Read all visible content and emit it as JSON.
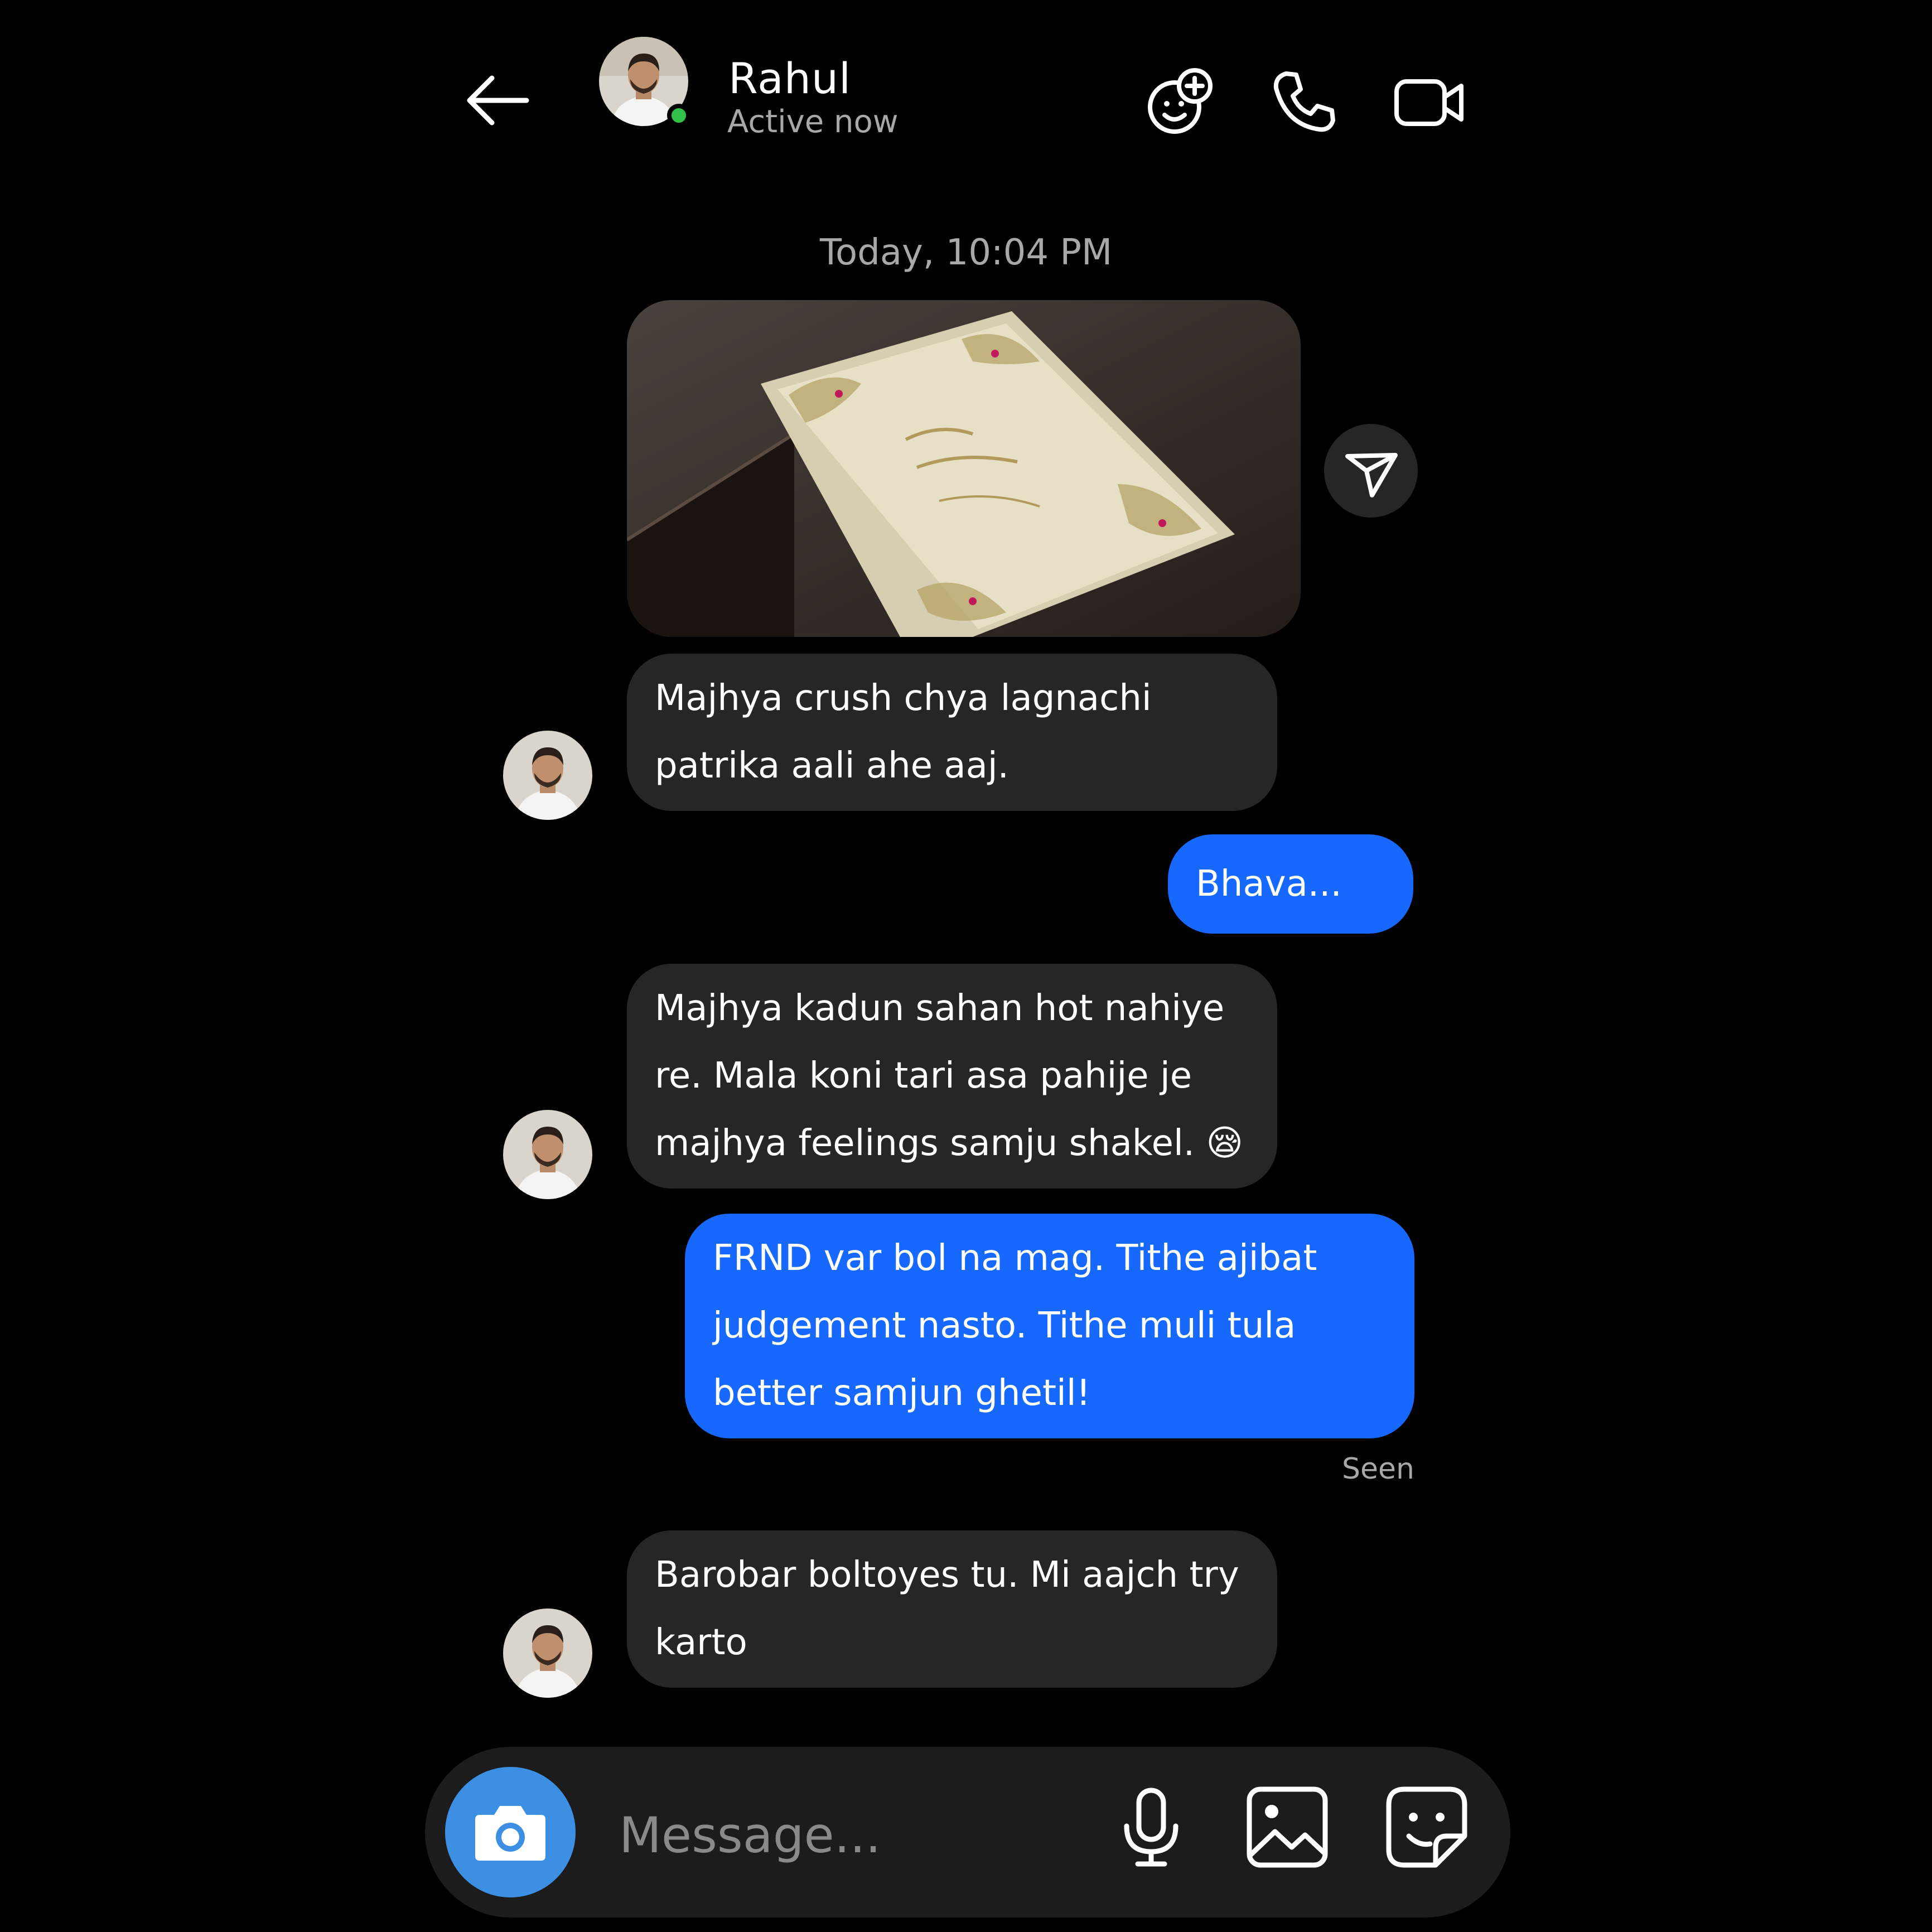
{
  "header": {
    "contact_name": "Rahul",
    "status": "Active now",
    "online_color": "#31c048",
    "icons": [
      "back-arrow-icon",
      "effects-icon",
      "phone-icon",
      "video-camera-icon"
    ]
  },
  "thread": {
    "timestamp": "Today, 10:04 PM",
    "messages": [
      {
        "sender": "Rahul",
        "type": "image",
        "description_icon": "invitation-photo"
      },
      {
        "sender": "Rahul",
        "type": "text",
        "text": "Majhya crush chya lagnachi\npatrika aali ahe aaj."
      },
      {
        "sender": "me",
        "type": "text",
        "text": "Bhava... 💔"
      },
      {
        "sender": "Rahul",
        "type": "text",
        "text": "Majhya kadun sahan hot nahiye\nre. Mala koni tari asa pahije je\nmajhya feelings samju shakel. 😪"
      },
      {
        "sender": "me",
        "type": "text",
        "text": "FRND var bol na mag. Tithe ajibat\njudgement nasto. Tithe muli tula\nbetter samjun ghetil!"
      },
      {
        "sender": "Rahul",
        "type": "text",
        "text": "Barobar boltoyes tu. Mi aajch try\nkarto"
      }
    ],
    "seen_label": "Seen"
  },
  "composer": {
    "placeholder": "Message...",
    "value": "",
    "icons": [
      "camera-icon",
      "microphone-icon",
      "gallery-icon",
      "sticker-icon"
    ]
  },
  "colors": {
    "background": "#000000",
    "incoming_bubble": "#262626",
    "outgoing_bubble": "#1668ff",
    "camera_button": "#3d8fe3",
    "secondary_text": "#a8a8a8"
  }
}
